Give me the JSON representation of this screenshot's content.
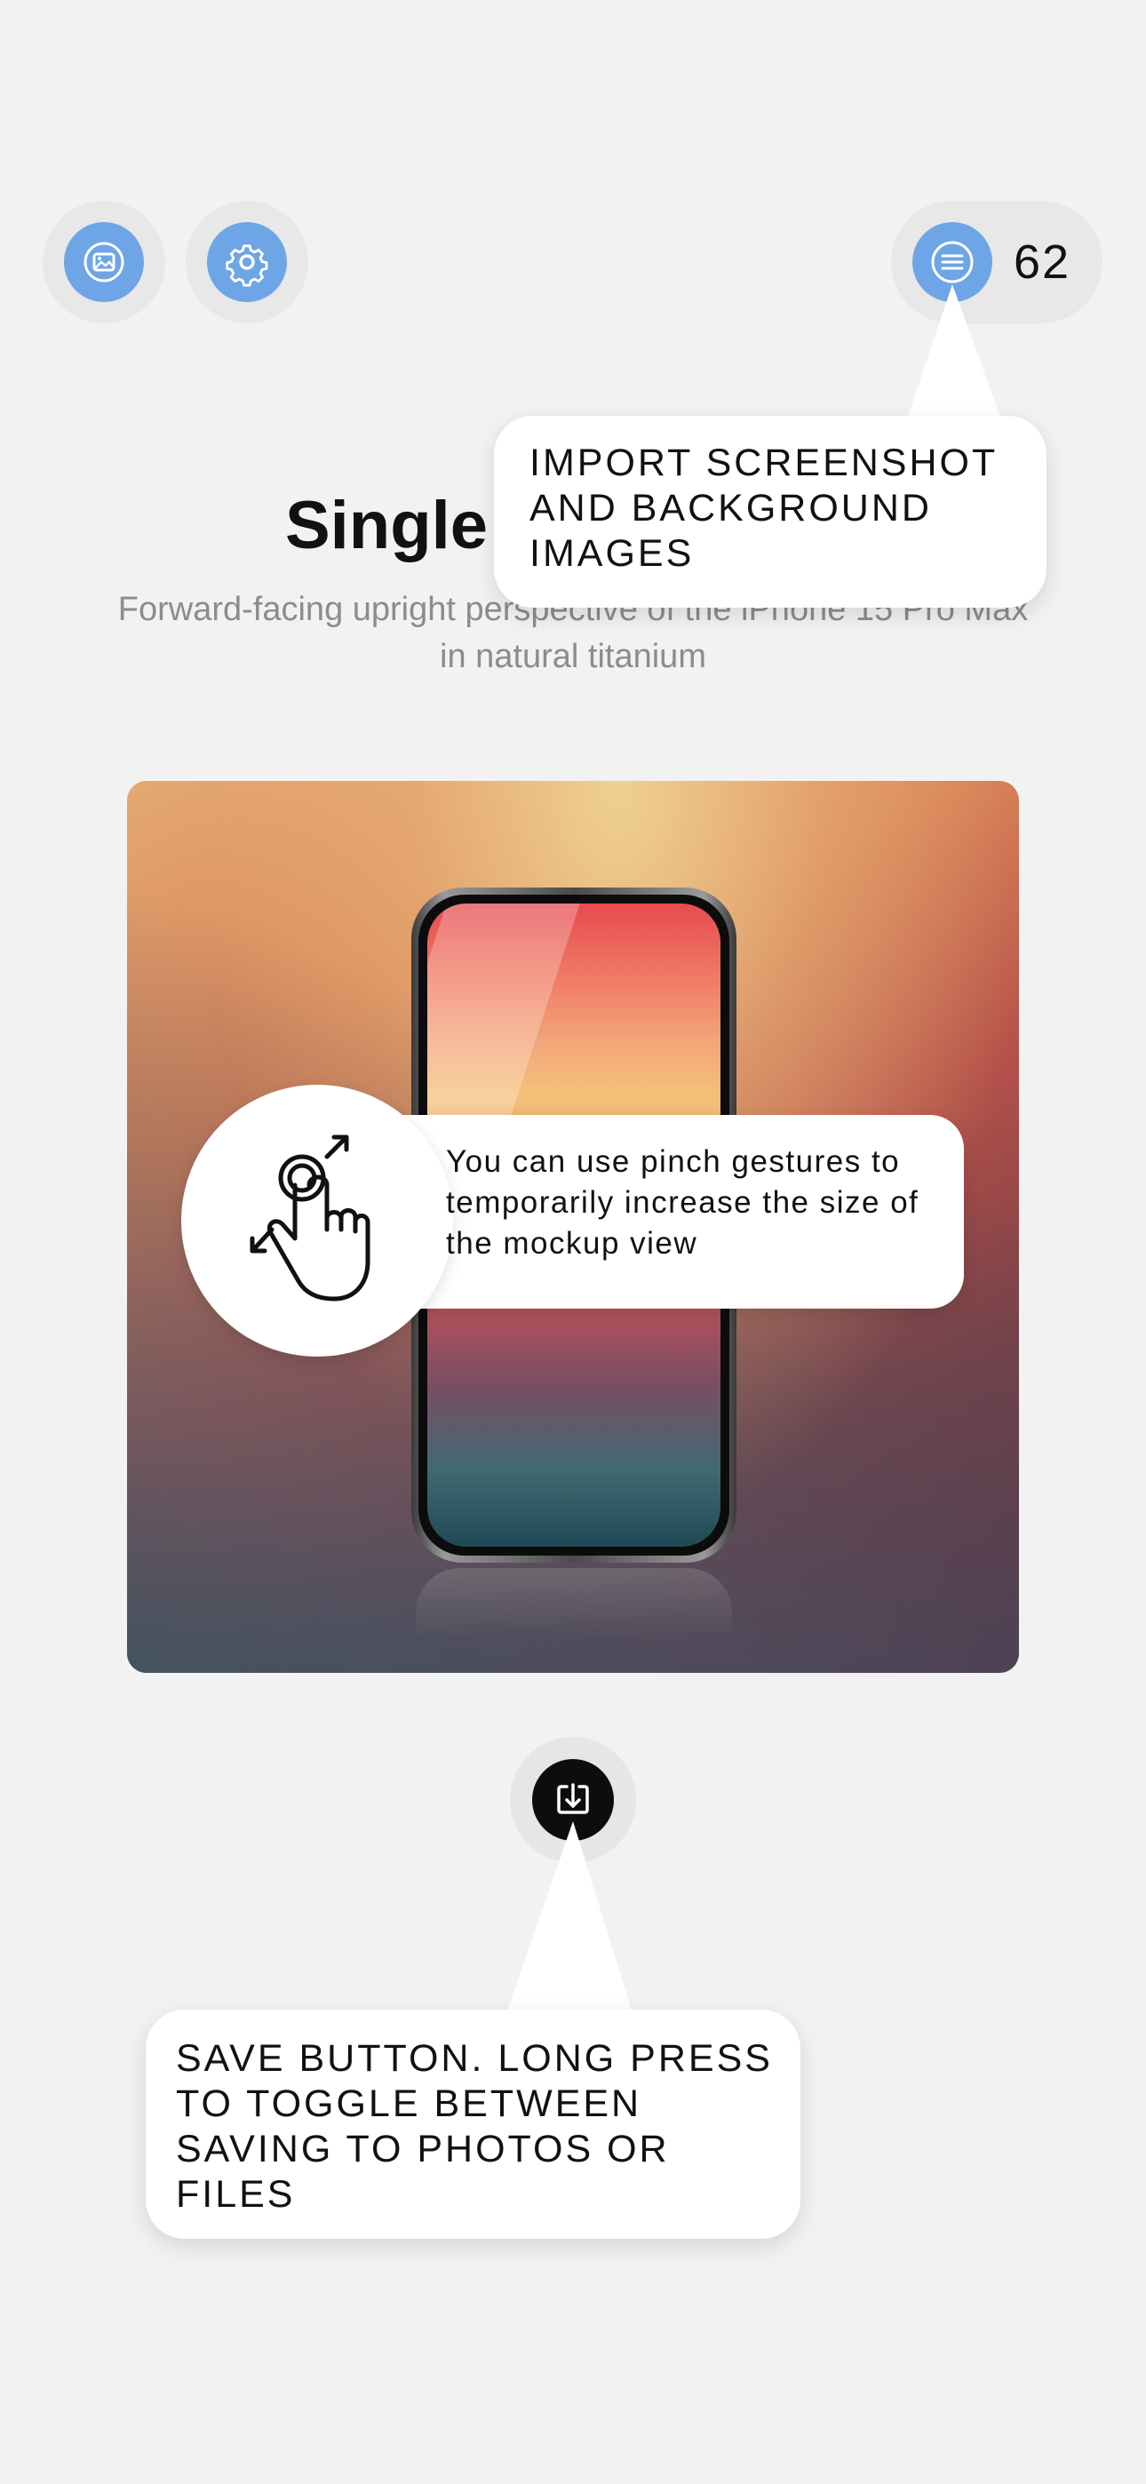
{
  "toolbar": {
    "import_images_icon": "photo-icon",
    "settings_icon": "gear-icon",
    "menu_icon": "list-icon",
    "count": "62"
  },
  "header": {
    "title": "Single",
    "subtitle": "Forward-facing upright perspective of the iPhone 15 Pro Max in natural titanium"
  },
  "tooltips": {
    "import": "IMPORT SCREENSHOT AND BACKGROUND IMAGES",
    "pinch": "You can use pinch gestures to temporarily increase the size of the mockup view",
    "save": "SAVE BUTTON. LONG PRESS TO TOGGLE BETWEEN SAVING TO PHOTOS OR FILES"
  },
  "colors": {
    "accent": "#6ea5e6",
    "background": "#f2f2f2"
  }
}
